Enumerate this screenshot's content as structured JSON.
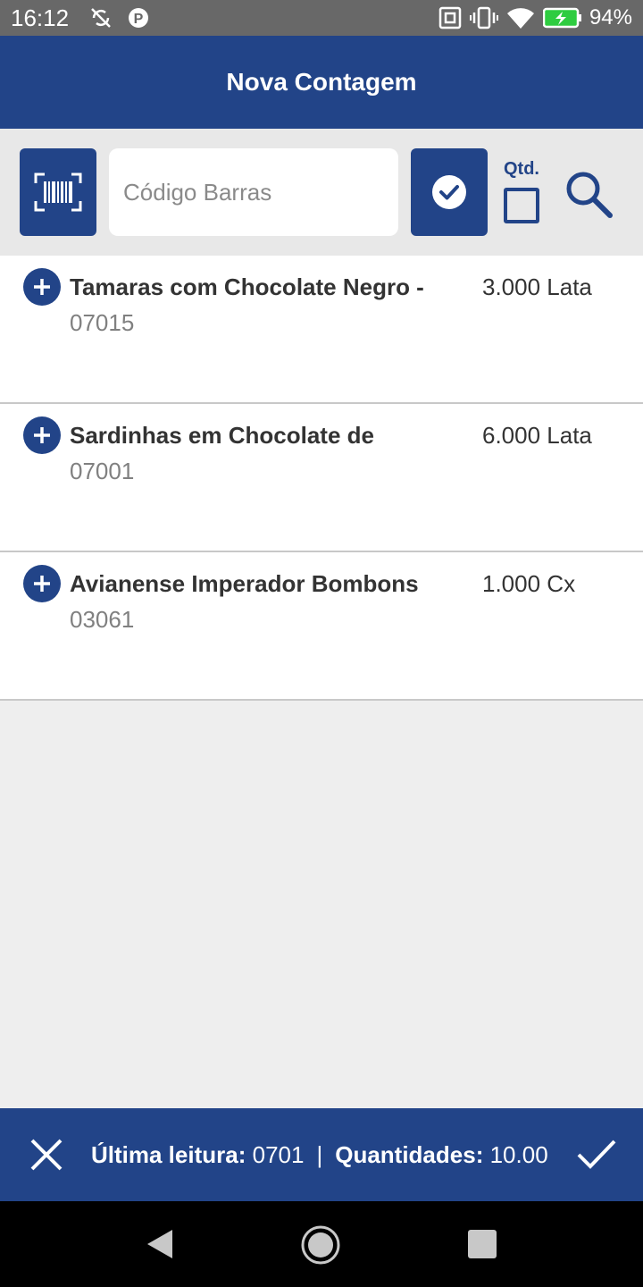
{
  "status_bar": {
    "time": "16:12",
    "battery": "94%",
    "icons": [
      "sync-off-icon",
      "parking-icon",
      "nfc-icon",
      "vibrate-icon",
      "wifi-icon",
      "battery-charging-icon"
    ]
  },
  "header": {
    "title": "Nova Contagem"
  },
  "toolbar": {
    "barcode_placeholder": "Código Barras",
    "barcode_value": "",
    "qty_label": "Qtd.",
    "qty_checked": false
  },
  "items": [
    {
      "name": "Tamaras com Chocolate Negro -",
      "code": "07015",
      "quantity": "3.000 Lata"
    },
    {
      "name": "Sardinhas em Chocolate de",
      "code": "07001",
      "quantity": "6.000 Lata"
    },
    {
      "name": "Avianense Imperador Bombons",
      "code": "03061",
      "quantity": "1.000 Cx"
    }
  ],
  "footer": {
    "last_read_label": "Última leitura:",
    "last_read_value": "0701",
    "separator": "|",
    "quantities_label": "Quantidades:",
    "quantities_value": "10.00"
  },
  "colors": {
    "primary": "#224488",
    "status_bar": "#686868",
    "background": "#eeeeee"
  }
}
